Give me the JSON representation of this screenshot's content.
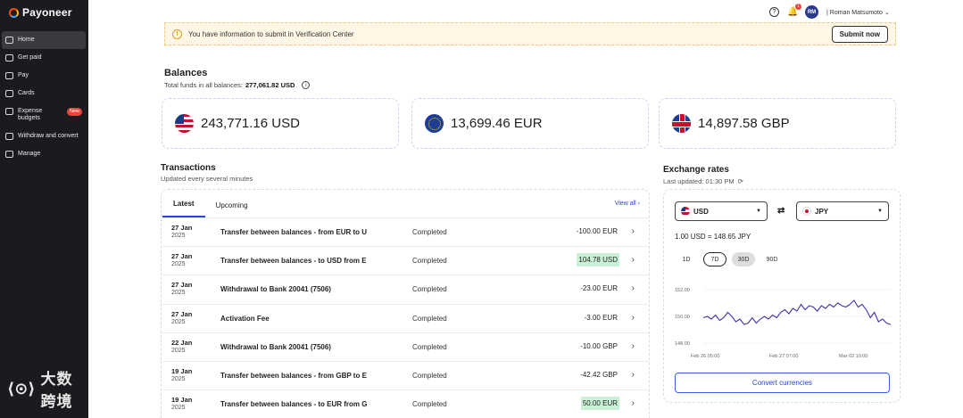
{
  "brand": {
    "name": "Payoneer"
  },
  "sidebar": {
    "items": [
      {
        "label": "Home",
        "active": true,
        "icon": "home-icon"
      },
      {
        "label": "Get paid",
        "icon": "get-paid-icon"
      },
      {
        "label": "Pay",
        "icon": "pay-icon"
      },
      {
        "label": "Cards",
        "icon": "card-icon"
      },
      {
        "label": "Expense budgets",
        "badge": "New",
        "icon": "budget-icon"
      },
      {
        "label": "Withdraw and convert",
        "icon": "withdraw-icon"
      },
      {
        "label": "Manage",
        "icon": "manage-icon"
      }
    ]
  },
  "topbar": {
    "help_icon": "help-icon",
    "notifications_count": "1",
    "avatar_initials": "RM",
    "user_name": "Roman Matsumoto"
  },
  "alert": {
    "message": "You have information to submit in Verification Center",
    "button": "Submit now"
  },
  "balances": {
    "title": "Balances",
    "total_label": "Total funds in all balances:",
    "total_value": "277,061.82 USD",
    "cards": [
      {
        "currency": "USD",
        "amount": "243,771.16 USD"
      },
      {
        "currency": "EUR",
        "amount": "13,699.46 EUR"
      },
      {
        "currency": "GBP",
        "amount": "14,897.58 GBP"
      }
    ]
  },
  "transactions": {
    "title": "Transactions",
    "subtitle": "Updated every several minutes",
    "tabs": [
      "Latest",
      "Upcoming"
    ],
    "view_all": "View all",
    "rows": [
      {
        "day": "27 Jan",
        "year": "2025",
        "desc": "Transfer between balances - from EUR to U",
        "status": "Completed",
        "amount": "-100.00 EUR",
        "positive": false
      },
      {
        "day": "27 Jan",
        "year": "2025",
        "desc": "Transfer between balances - to USD from E",
        "status": "Completed",
        "amount": "104.78 USD",
        "positive": true
      },
      {
        "day": "27 Jan",
        "year": "2025",
        "desc": "Withdrawal to Bank 20041 (7506)",
        "status": "Completed",
        "amount": "-23.00 EUR",
        "positive": false
      },
      {
        "day": "27 Jan",
        "year": "2025",
        "desc": "Activation Fee",
        "status": "Completed",
        "amount": "-3.00 EUR",
        "positive": false
      },
      {
        "day": "22 Jan",
        "year": "2025",
        "desc": "Withdrawal to Bank 20041 (7506)",
        "status": "Completed",
        "amount": "-10.00 GBP",
        "positive": false
      },
      {
        "day": "19 Jan",
        "year": "2025",
        "desc": "Transfer between balances - from GBP to E",
        "status": "Completed",
        "amount": "-42.42 GBP",
        "positive": false
      },
      {
        "day": "19 Jan",
        "year": "2025",
        "desc": "Transfer between balances - to EUR from G",
        "status": "Completed",
        "amount": "50.00 EUR",
        "positive": true
      }
    ]
  },
  "exchange": {
    "title": "Exchange rates",
    "last_updated": "Last updated: 01:30 PM",
    "from": "USD",
    "to": "JPY",
    "rate": "1.00 USD = 148.65 JPY",
    "periods": [
      "1D",
      "7D",
      "30D",
      "90D"
    ],
    "selected_period": "7D",
    "convert_button": "Convert currencies"
  },
  "chart_data": {
    "type": "line",
    "y_ticks": [
      "152.00",
      "150.00",
      "148.00"
    ],
    "x_ticks": [
      "Feb 26 05:00",
      "Feb 27 07:00",
      "Mar 02 10:00"
    ],
    "ylim": [
      148,
      152
    ],
    "series": [
      {
        "values": [
          149.9,
          150.0,
          149.8,
          150.1,
          149.7,
          149.9,
          150.3,
          150.0,
          149.6,
          149.8,
          149.4,
          149.5,
          149.9,
          149.5,
          149.8,
          150.0,
          149.8,
          150.1,
          149.9,
          150.3,
          150.5,
          150.2,
          150.6,
          150.4,
          150.9,
          150.5,
          150.8,
          150.7,
          150.4,
          150.8,
          150.6,
          150.9,
          150.7,
          151.0,
          150.8,
          150.7,
          150.9,
          151.2,
          150.7,
          150.9,
          150.5,
          149.9,
          150.3,
          149.6,
          149.8,
          149.5,
          149.4
        ]
      }
    ],
    "colors": {
      "line": "#4b2fa8"
    }
  }
}
